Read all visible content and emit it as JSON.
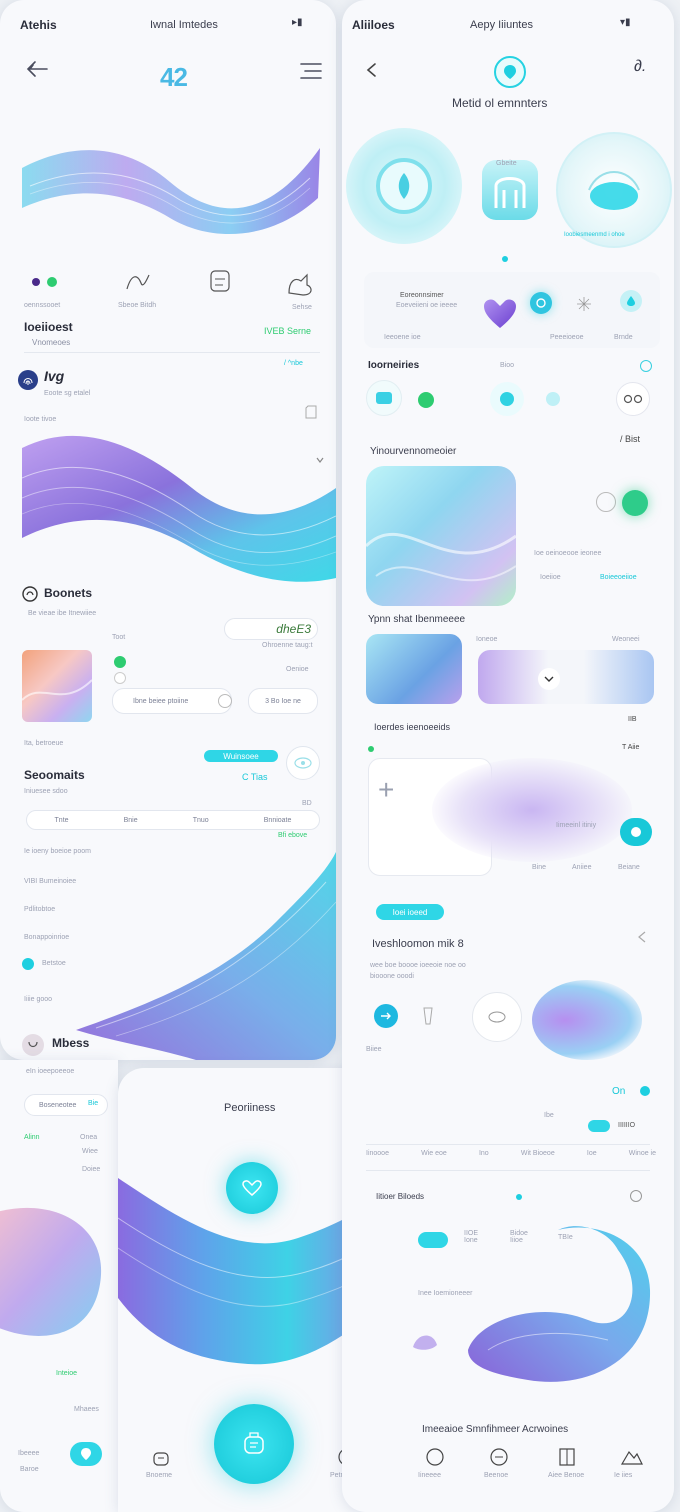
{
  "left": {
    "status_time": "Atehis",
    "status_title": "Iwnal Imtedes",
    "status_signal": "▸▮",
    "header_logo": "42",
    "chips_row": [
      "oennssooet",
      "Sbeoe Bitdh",
      "",
      "Sehse"
    ],
    "section1": {
      "title": "Ioeiioest",
      "subtitle": "Vnomeoes",
      "link": "IVEB Serne"
    },
    "row_label": "/ ^nbe",
    "item1": {
      "title": "Ivg",
      "subtitle": "Eoote sg etalel"
    },
    "caption1": "Ioote tivoe",
    "brand": {
      "title": "Boonets",
      "subtitle": "Be vieae ibe Itnewiiee"
    },
    "script_label": "dheE3",
    "meta": {
      "a": "Toot",
      "b": "Ohroenne taug:t",
      "c": "Oenioe"
    },
    "media_caption": "Ibne beiee ptoiine",
    "toggle": {
      "a": "3 Bo",
      "b": "Ioe ne"
    },
    "footer_label": "Ita, betroeue",
    "cta_pill": "Wuinsoee",
    "section2": {
      "title": "Seoomaits",
      "link": "C Tias",
      "subtitle": "Iniuesee sdoo"
    },
    "tabs": [
      "Tnte",
      "Bnie",
      "Tnuo",
      "Bnnioate"
    ],
    "tab_badge": "Bfi ebove",
    "rd_label": "BD",
    "list": [
      "Ie ioeny boeioe poom",
      "VIBI Bumeinoiee",
      "Pdlitobtoe",
      "Bonappoinrioe",
      "Betstoe"
    ],
    "list_footer": "Iiiie gooo",
    "section3": {
      "title": "Mbess",
      "subtitle": "eIn ioeepoeeoe"
    },
    "search_placeholder": "Boseneotee",
    "search_btn": "Bie",
    "filters": {
      "a": "Alinn",
      "b": "Onea",
      "c": "Wiee",
      "d": "Doiee"
    }
  },
  "bottom_left": {
    "label_a": "Inteioe",
    "label_b": "Mhaees",
    "nav_a": "Ibeeee",
    "nav_b": "Baroe"
  },
  "bottom_mid": {
    "title": "Peoriiness",
    "nav_left": "Bnoeme",
    "nav_right": "Petniee"
  },
  "right": {
    "status_time": "Aliiloes",
    "status_title": "Aepy Iiiuntes",
    "status_signal": "▾▮",
    "header_title": "Metid ol emnnters",
    "hero_labels": {
      "a": "Gbeite",
      "b": "Ioobiesmeenmd i ohoe"
    },
    "promo": {
      "title": "Eoreonnsimer",
      "subtitle": "Eoeveiieni oe ieeee",
      "c1": "Ieeoene ioe",
      "c2": "Peeeioeoe",
      "c3": "Brnde"
    },
    "section1": {
      "title": "Ioorneiries",
      "link": "Bioo"
    },
    "section2": {
      "title": "Yinourvennomeoier",
      "link": "/ Bist"
    },
    "card_meta": {
      "a": "Ioe oeinoeooe ieonee",
      "b": "Ioeiioe",
      "c": "Boieeoeiioe"
    },
    "section3": {
      "title": "Ypnn shat Ibenmeeee",
      "a": "Ioneoe",
      "b": "Weoneei"
    },
    "section4": {
      "title": "Ioerdes ieenoeeids",
      "link": "IIB",
      "link2": "T Aiie"
    },
    "card2": {
      "label": "Iimeeinl itiniy",
      "a": "Bine",
      "b": "Aniiee",
      "c": "Beiane"
    },
    "pill": "Ioei ioeed",
    "section5": {
      "title": "Iveshloomon mik 8",
      "subtitle": "wee boe boooe ioeeoie noe oo biooone ooodi"
    },
    "row_label": "Biiee",
    "toggle": "On",
    "mini": {
      "a": "Ibe",
      "b": "IIIIIIO"
    },
    "table": [
      "Iinoooe",
      "Wie eoe",
      "Ino",
      "Wit Bioeoe",
      "Ioe",
      "Winoe ie"
    ],
    "section6": {
      "title": "Iitioer Biloeds",
      "chips": [
        "",
        "IIOE Ione",
        "Bidoe Iiioe",
        "TBIe"
      ]
    },
    "section6_sub": "Inee Ioemioneeer",
    "footer_title": "Imeeaioe Smnfihmeer Acrwoines",
    "nav": [
      "Iineeee",
      "Beenoe",
      "Aiee Benoe",
      "Ie iies"
    ]
  },
  "colors": {
    "accent": "#1ecfe0",
    "purple": "#8b6be0",
    "green": "#28c76f"
  }
}
